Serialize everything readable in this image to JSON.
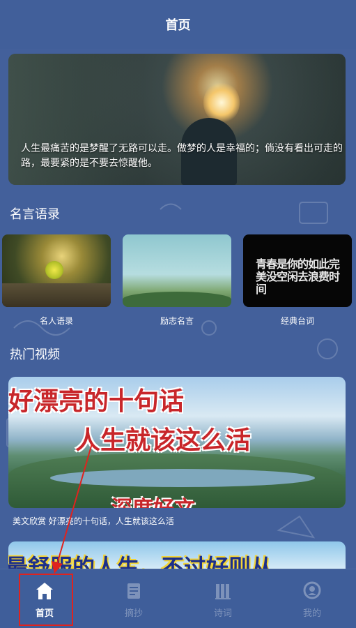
{
  "header": {
    "title": "首页"
  },
  "banner": {
    "quote": "人生最痛苦的是梦醒了无路可以走。做梦的人是幸福的；倘没有看出可走的路，最要紧的是不要去惊醒他。"
  },
  "quotes_section": {
    "title": "名言语录",
    "items": [
      {
        "label": "名人语录"
      },
      {
        "label": "励志名言"
      },
      {
        "label": "经典台词",
        "thumb_text": "青春是你的如此完美没空闲去浪费时间"
      }
    ]
  },
  "video_section": {
    "title": "热门视频",
    "video": {
      "overlay_line1": "好漂亮的十句话",
      "overlay_line2": "人生就该这么活",
      "overlay_line3": "深度好文",
      "caption": "美文欣赏 好漂亮的十句话，人生就该这么活"
    },
    "video2": {
      "overlay_line1": "最舒服的人生，不过好则从"
    }
  },
  "tabbar": {
    "tabs": [
      {
        "label": "首页",
        "icon": "home-icon",
        "active": true
      },
      {
        "label": "摘抄",
        "icon": "notebook-icon",
        "active": false
      },
      {
        "label": "诗词",
        "icon": "books-icon",
        "active": false
      },
      {
        "label": "我的",
        "icon": "profile-icon",
        "active": false
      }
    ]
  },
  "colors": {
    "background": "#43609b",
    "annotation_red": "#e0231e"
  }
}
